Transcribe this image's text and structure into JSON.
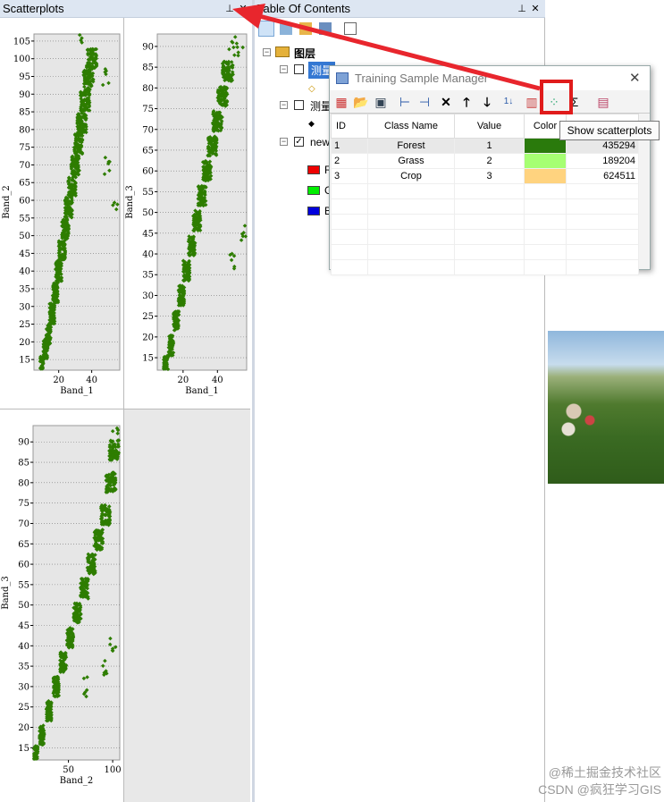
{
  "scatter_panel": {
    "title": "Scatterplots",
    "pin_icon": "pin-icon",
    "close_icon": "close-icon"
  },
  "toc_panel": {
    "title": "Table Of Contents",
    "root_label": "图层",
    "layers": [
      {
        "label": "测量",
        "selected": true
      },
      {
        "label": "测量",
        "selected": false
      },
      {
        "label": "new",
        "selected": false
      }
    ],
    "band_items": [
      "R",
      "G",
      "B"
    ],
    "band_colors": [
      "#ee0000",
      "#00ee00",
      "#0000dd"
    ]
  },
  "dialog": {
    "title": "Training Sample Manager",
    "columns": [
      "ID",
      "Class Name",
      "Value",
      "Color",
      ""
    ],
    "rows": [
      {
        "id": "1",
        "name": "Forest",
        "value": "1",
        "color": "#2a7a0c",
        "count": "435294"
      },
      {
        "id": "2",
        "name": "Grass",
        "value": "2",
        "color": "#a6ff73",
        "count": "189204"
      },
      {
        "id": "3",
        "name": "Crop",
        "value": "3",
        "color": "#ffd37f",
        "count": "624511"
      }
    ],
    "tooltip": "Show scatterplots",
    "toolbar_icons": [
      "new-icon",
      "open-icon",
      "save-icon",
      "merge-icon",
      "split-icon",
      "delete-icon",
      "move-up-icon",
      "move-down-icon",
      "sort-icon",
      "histogram-icon",
      "scatterplot-icon",
      "statistics-icon",
      "evaluate-icon"
    ]
  },
  "watermark": {
    "line1": "@稀土掘金技术社区",
    "line2": "CSDN @疯狂学习GIS"
  },
  "chart_data": [
    {
      "type": "scatter",
      "title": "",
      "xlabel": "Band_1",
      "ylabel": "Band_2",
      "xticks": [
        20,
        40
      ],
      "yticks": [
        15,
        20,
        25,
        30,
        35,
        40,
        45,
        50,
        55,
        60,
        65,
        70,
        75,
        80,
        85,
        90,
        95,
        100,
        105
      ],
      "xlim": [
        5,
        57
      ],
      "ylim": [
        12,
        107
      ],
      "color": "#2e7d00",
      "series": [
        {
          "points": [
            [
              10,
              13
            ],
            [
              12,
              18
            ],
            [
              14,
              22
            ],
            [
              16,
              28
            ],
            [
              18,
              34
            ],
            [
              20,
              40
            ],
            [
              22,
              46
            ],
            [
              24,
              52
            ],
            [
              26,
              58
            ],
            [
              28,
              64
            ],
            [
              30,
              70
            ],
            [
              32,
              76
            ],
            [
              34,
              82
            ],
            [
              36,
              88
            ],
            [
              38,
              94
            ],
            [
              40,
              100
            ],
            [
              34,
              105
            ],
            [
              48,
              95
            ],
            [
              50,
              70
            ],
            [
              55,
              59
            ]
          ]
        }
      ]
    },
    {
      "type": "scatter",
      "title": "",
      "xlabel": "Band_1",
      "ylabel": "Band_3",
      "xticks": [
        20,
        40
      ],
      "yticks": [
        15,
        20,
        25,
        30,
        35,
        40,
        45,
        50,
        55,
        60,
        65,
        70,
        75,
        80,
        85,
        90
      ],
      "xlim": [
        5,
        57
      ],
      "ylim": [
        12,
        93
      ],
      "color": "#2e7d00",
      "series": [
        {
          "points": [
            [
              10,
              13
            ],
            [
              13,
              18
            ],
            [
              16,
              24
            ],
            [
              19,
              30
            ],
            [
              22,
              36
            ],
            [
              25,
              42
            ],
            [
              28,
              48
            ],
            [
              31,
              54
            ],
            [
              34,
              60
            ],
            [
              37,
              66
            ],
            [
              40,
              72
            ],
            [
              43,
              78
            ],
            [
              46,
              84
            ],
            [
              50,
              90
            ],
            [
              52,
              92
            ],
            [
              55,
              45
            ],
            [
              48,
              38
            ]
          ]
        }
      ]
    },
    {
      "type": "scatter",
      "title": "",
      "xlabel": "Band_2",
      "ylabel": "Band_3",
      "xticks": [
        50,
        100
      ],
      "yticks": [
        15,
        20,
        25,
        30,
        35,
        40,
        45,
        50,
        55,
        60,
        65,
        70,
        75,
        80,
        85,
        90
      ],
      "xlim": [
        10,
        108
      ],
      "ylim": [
        12,
        94
      ],
      "color": "#2e7d00",
      "series": [
        {
          "points": [
            [
              13,
              13
            ],
            [
              20,
              18
            ],
            [
              28,
              24
            ],
            [
              36,
              30
            ],
            [
              44,
              36
            ],
            [
              52,
              42
            ],
            [
              60,
              48
            ],
            [
              68,
              54
            ],
            [
              76,
              60
            ],
            [
              84,
              66
            ],
            [
              92,
              72
            ],
            [
              98,
              80
            ],
            [
              102,
              88
            ],
            [
              105,
              93
            ],
            [
              100,
              40
            ],
            [
              90,
              35
            ],
            [
              70,
              30
            ]
          ]
        }
      ]
    }
  ]
}
